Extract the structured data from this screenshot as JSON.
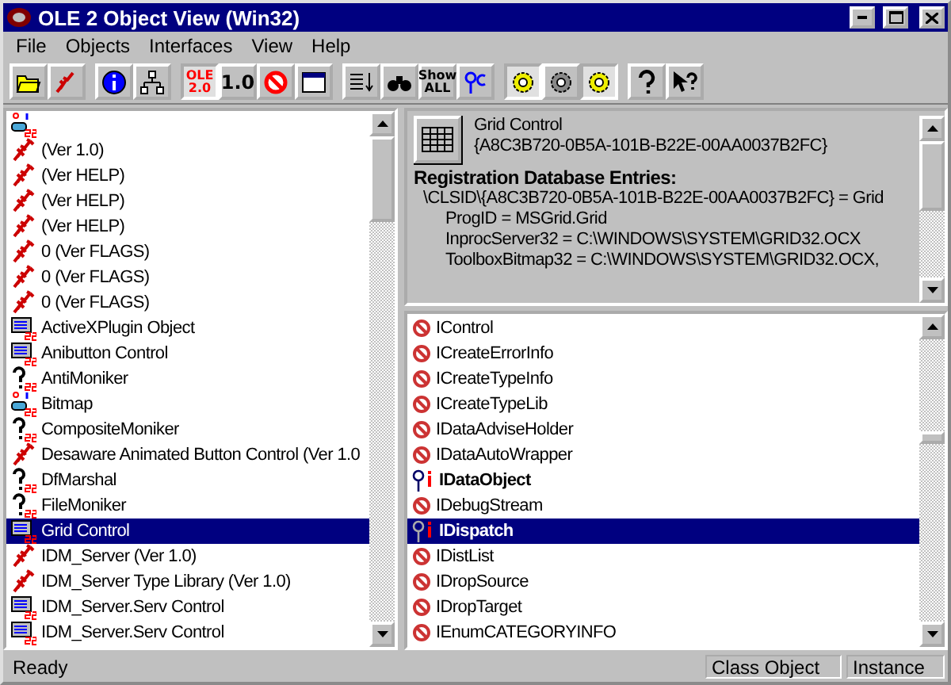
{
  "window": {
    "title": "OLE 2 Object View (Win32)"
  },
  "menu": [
    "File",
    "Objects",
    "Interfaces",
    "View",
    "Help"
  ],
  "toolbar": [
    [
      {
        "kind": "open"
      },
      {
        "kind": "rockets"
      }
    ],
    [
      {
        "kind": "info"
      },
      {
        "kind": "tree"
      }
    ],
    [
      {
        "kind": "ole",
        "label": "OLE 2.0",
        "pressed": true
      },
      {
        "kind": "text",
        "label": "1.0"
      },
      {
        "kind": "nosign"
      },
      {
        "kind": "window"
      }
    ],
    [
      {
        "kind": "list"
      },
      {
        "kind": "binoculars"
      },
      {
        "kind": "show",
        "label": "Show ALL"
      },
      {
        "kind": "keyc"
      }
    ],
    [
      {
        "kind": "gear",
        "pressed": true
      },
      {
        "kind": "gear2"
      },
      {
        "kind": "gear",
        "pressed": true
      }
    ],
    [
      {
        "kind": "help"
      },
      {
        "kind": "pointerhelp"
      }
    ]
  ],
  "objects": [
    {
      "kind": "app",
      "selected": false
    },
    {
      "kind": "typelib",
      "label": "(Ver 1.0)",
      "selected": false
    },
    {
      "kind": "typelib",
      "label": "(Ver HELP)",
      "selected": false
    },
    {
      "kind": "typelib",
      "label": "(Ver HELP)",
      "selected": false
    },
    {
      "kind": "typelib",
      "label": "(Ver HELP)",
      "selected": false
    },
    {
      "kind": "typelib",
      "label": "0 (Ver FLAGS)",
      "selected": false
    },
    {
      "kind": "typelib",
      "label": "0 (Ver FLAGS)",
      "selected": false
    },
    {
      "kind": "typelib",
      "label": "0 (Ver FLAGS)",
      "selected": false
    },
    {
      "kind": "ocx",
      "label": "ActiveXPlugin Object",
      "selected": false
    },
    {
      "kind": "ocx",
      "label": "Anibutton Control",
      "selected": false
    },
    {
      "kind": "unknown",
      "label": "AntiMoniker",
      "selected": false
    },
    {
      "kind": "app",
      "label": "Bitmap",
      "selected": false
    },
    {
      "kind": "unknown",
      "label": "CompositeMoniker",
      "selected": false
    },
    {
      "kind": "typelib",
      "label": "Desaware Animated Button Control (Ver 1.0",
      "selected": false
    },
    {
      "kind": "unknown",
      "label": "DfMarshal",
      "selected": false
    },
    {
      "kind": "unknown",
      "label": "FileMoniker",
      "selected": false
    },
    {
      "kind": "ocx",
      "label": "Grid Control",
      "selected": true
    },
    {
      "kind": "typelib",
      "label": "IDM_Server (Ver 1.0)",
      "selected": false
    },
    {
      "kind": "typelib",
      "label": "IDM_Server Type Library (Ver 1.0)",
      "selected": false
    },
    {
      "kind": "ocx",
      "label": "IDM_Server.Serv Control",
      "selected": false
    },
    {
      "kind": "ocx",
      "label": "IDM_Server.Serv Control",
      "selected": false
    }
  ],
  "details": {
    "name": "Grid Control",
    "clsid": "{A8C3B720-0B5A-101B-B22E-00AA0037B2FC}",
    "heading": "Registration Database Entries:",
    "entries": [
      {
        "text": "\\CLSID\\{A8C3B720-0B5A-101B-B22E-00AA0037B2FC} = Grid",
        "children": [
          {
            "text": "ProgID = MSGrid.Grid"
          },
          {
            "text": "InprocServer32 = C:\\WINDOWS\\SYSTEM\\GRID32.OCX"
          },
          {
            "text": "ToolboxBitmap32 = C:\\WINDOWS\\SYSTEM\\GRID32.OCX,"
          }
        ]
      }
    ]
  },
  "interfaces": [
    {
      "label": "IControl",
      "supported": false,
      "selected": false
    },
    {
      "label": "ICreateErrorInfo",
      "supported": false,
      "selected": false
    },
    {
      "label": "ICreateTypeInfo",
      "supported": false,
      "selected": false
    },
    {
      "label": "ICreateTypeLib",
      "supported": false,
      "selected": false
    },
    {
      "label": "IDataAdviseHolder",
      "supported": false,
      "selected": false
    },
    {
      "label": "IDataAutoWrapper",
      "supported": false,
      "selected": false
    },
    {
      "label": "IDataObject",
      "supported": true,
      "selected": false
    },
    {
      "label": "IDebugStream",
      "supported": false,
      "selected": false
    },
    {
      "label": "IDispatch",
      "supported": true,
      "selected": true
    },
    {
      "label": "IDistList",
      "supported": false,
      "selected": false
    },
    {
      "label": "IDropSource",
      "supported": false,
      "selected": false
    },
    {
      "label": "IDropTarget",
      "supported": false,
      "selected": false
    },
    {
      "label": "IEnumCATEGORYINFO",
      "supported": false,
      "selected": false
    }
  ],
  "status_bar": [
    "Ready",
    "Class Object",
    "Instance"
  ]
}
